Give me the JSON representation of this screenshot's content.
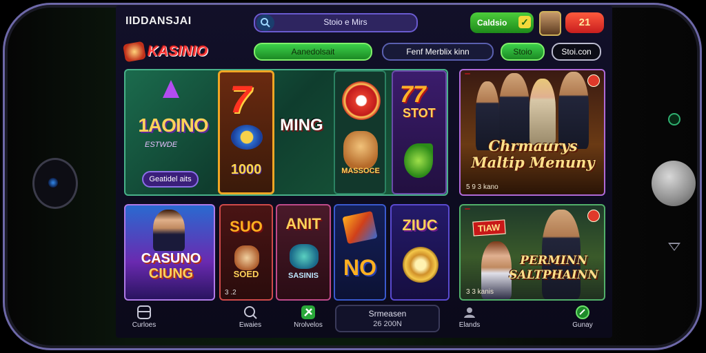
{
  "header": {
    "app_title": "IIDDANSJAI",
    "search_text": "Stoio e Mirs",
    "wallet_label": "Caldsio",
    "wallet_check": "✓",
    "notification_count": "21"
  },
  "brand": {
    "logo_text": "KASINIO"
  },
  "filters": [
    {
      "label": "Aanedolsait"
    },
    {
      "label": "Fenf Merblix kinn"
    },
    {
      "label": "Stoio"
    },
    {
      "label": "Stoi.con"
    }
  ],
  "featured": {
    "title": "1AOINO",
    "subtitle": "ESTWDE",
    "button": "Geatidel aits",
    "slot_777": {
      "symbol": "7",
      "value": "1000"
    },
    "ming_label": "MING",
    "chips_label": "MASSOCE",
    "purple_symbol": "77",
    "purple_label": "STOT"
  },
  "promo_top": {
    "title": "Chrmaurys Maltip Menuny",
    "caption": "5 9 3 kano"
  },
  "games": [
    {
      "title_1": "CASUNO",
      "title_2": "CIUNG"
    },
    {
      "title": "SUO",
      "sub": "SOED",
      "caption": "3 .2"
    },
    {
      "title": "ANIT",
      "sub": "SASINIS"
    },
    {
      "title": "NO"
    },
    {
      "title": "ZIUC"
    }
  ],
  "promo_bottom": {
    "badge": "TIAW",
    "title": "PERMINN SALTPHAINN",
    "caption": "3 3 kanis"
  },
  "nav": {
    "items": [
      {
        "label": "Curloes"
      },
      {
        "label": "Ewaies"
      },
      {
        "label": "Nrolvelos"
      },
      {
        "label": "Elands"
      },
      {
        "label": "Gunay"
      }
    ],
    "center_line1": "Srmeasen",
    "center_line2": "26 200N"
  },
  "colors": {
    "accent_green": "#3bd04a",
    "accent_purple": "#6a5bd0",
    "alert_red": "#e03a2a",
    "gold": "#ffd25a"
  }
}
